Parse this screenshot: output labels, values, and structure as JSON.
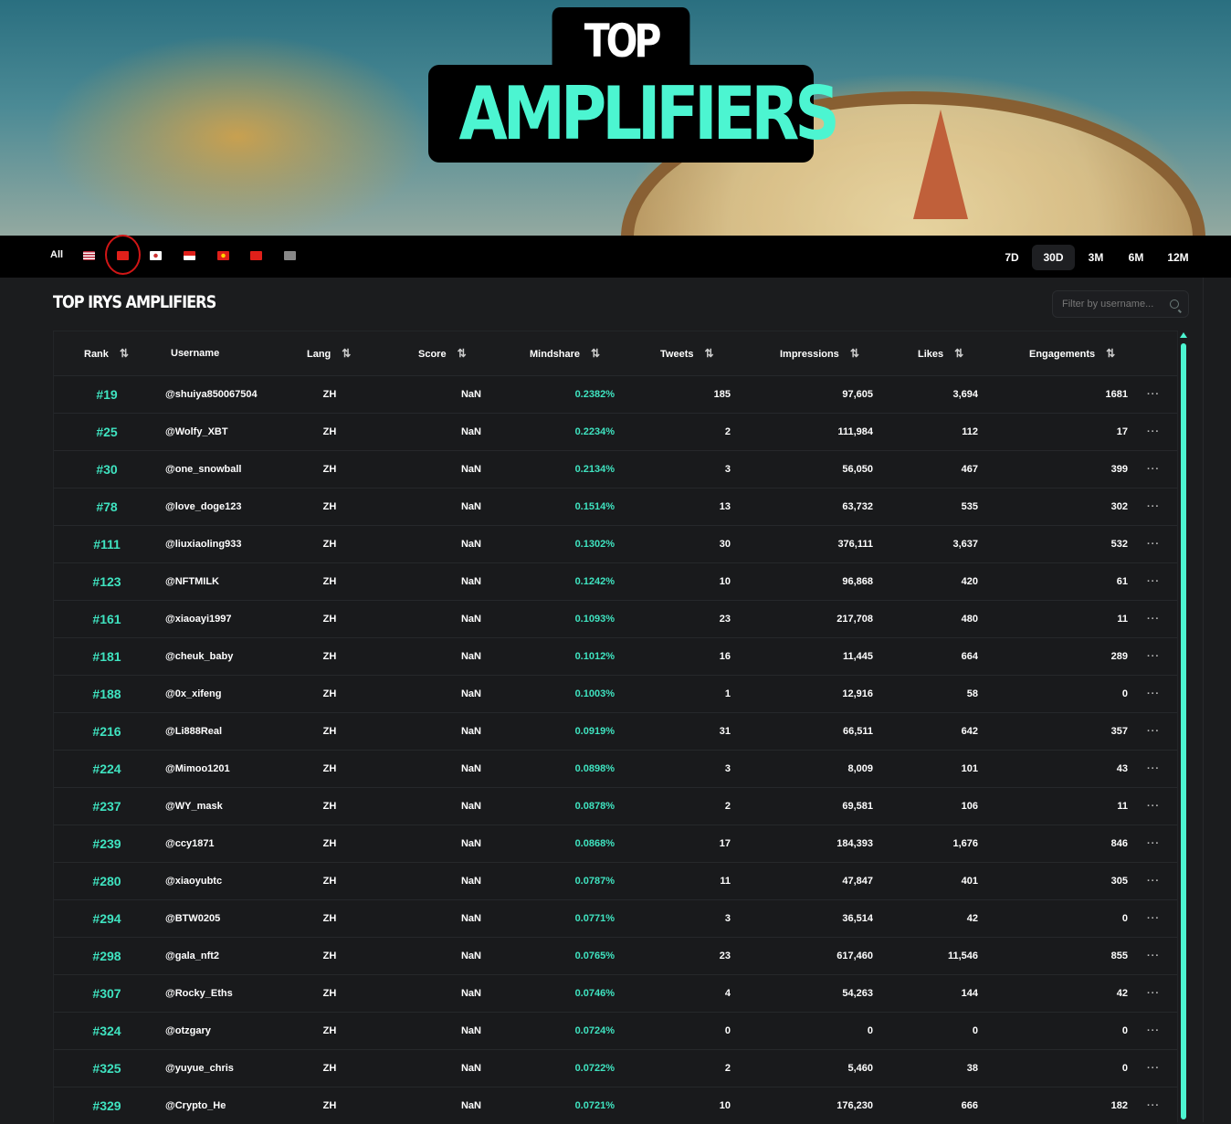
{
  "banner": {
    "title_top": "TOP IRYS",
    "title_bottom": "AMPLIFIERS"
  },
  "nav": {
    "all_label": "All",
    "flags": [
      {
        "name": "us",
        "color": "#b22234"
      },
      {
        "name": "cn",
        "color": "#e0201a",
        "selected": true
      },
      {
        "name": "kr",
        "color": "#ffffff"
      },
      {
        "name": "id",
        "color": "#e0201a"
      },
      {
        "name": "vn",
        "color": "#e0201a"
      },
      {
        "name": "tr",
        "color": "#e0201a"
      },
      {
        "name": "unknown",
        "color": "#888888"
      }
    ],
    "periods": [
      {
        "label": "7D"
      },
      {
        "label": "30D",
        "active": true
      },
      {
        "label": "3M"
      },
      {
        "label": "6M"
      },
      {
        "label": "12M"
      }
    ]
  },
  "page_title": "TOP IRYS AMPLIFIERS",
  "filter": {
    "placeholder": "Filter by username...",
    "icon": "search-icon"
  },
  "accent": "#4cf5d1",
  "columns": [
    "Rank",
    "Username",
    "Lang",
    "Score",
    "Mindshare",
    "Tweets",
    "Impressions",
    "Likes",
    "Engagements"
  ],
  "sort_icon": "⇅",
  "more_icon": "···",
  "rows": [
    {
      "rank": "#19",
      "user": "@shuiya850067504",
      "lang": "ZH",
      "score": "NaN",
      "mind": "0.2382%",
      "tweets": "185",
      "imp": "97,605",
      "likes": "3,694",
      "eng": "1681"
    },
    {
      "rank": "#25",
      "user": "@Wolfy_XBT",
      "lang": "ZH",
      "score": "NaN",
      "mind": "0.2234%",
      "tweets": "2",
      "imp": "111,984",
      "likes": "112",
      "eng": "17"
    },
    {
      "rank": "#30",
      "user": "@one_snowball",
      "lang": "ZH",
      "score": "NaN",
      "mind": "0.2134%",
      "tweets": "3",
      "imp": "56,050",
      "likes": "467",
      "eng": "399"
    },
    {
      "rank": "#78",
      "user": "@love_doge123",
      "lang": "ZH",
      "score": "NaN",
      "mind": "0.1514%",
      "tweets": "13",
      "imp": "63,732",
      "likes": "535",
      "eng": "302"
    },
    {
      "rank": "#111",
      "user": "@liuxiaoling933",
      "lang": "ZH",
      "score": "NaN",
      "mind": "0.1302%",
      "tweets": "30",
      "imp": "376,111",
      "likes": "3,637",
      "eng": "532"
    },
    {
      "rank": "#123",
      "user": "@NFTMILK",
      "lang": "ZH",
      "score": "NaN",
      "mind": "0.1242%",
      "tweets": "10",
      "imp": "96,868",
      "likes": "420",
      "eng": "61"
    },
    {
      "rank": "#161",
      "user": "@xiaoayi1997",
      "lang": "ZH",
      "score": "NaN",
      "mind": "0.1093%",
      "tweets": "23",
      "imp": "217,708",
      "likes": "480",
      "eng": "11"
    },
    {
      "rank": "#181",
      "user": "@cheuk_baby",
      "lang": "ZH",
      "score": "NaN",
      "mind": "0.1012%",
      "tweets": "16",
      "imp": "11,445",
      "likes": "664",
      "eng": "289"
    },
    {
      "rank": "#188",
      "user": "@0x_xifeng",
      "lang": "ZH",
      "score": "NaN",
      "mind": "0.1003%",
      "tweets": "1",
      "imp": "12,916",
      "likes": "58",
      "eng": "0"
    },
    {
      "rank": "#216",
      "user": "@Li888Real",
      "lang": "ZH",
      "score": "NaN",
      "mind": "0.0919%",
      "tweets": "31",
      "imp": "66,511",
      "likes": "642",
      "eng": "357"
    },
    {
      "rank": "#224",
      "user": "@Mimoo1201",
      "lang": "ZH",
      "score": "NaN",
      "mind": "0.0898%",
      "tweets": "3",
      "imp": "8,009",
      "likes": "101",
      "eng": "43"
    },
    {
      "rank": "#237",
      "user": "@WY_mask",
      "lang": "ZH",
      "score": "NaN",
      "mind": "0.0878%",
      "tweets": "2",
      "imp": "69,581",
      "likes": "106",
      "eng": "11"
    },
    {
      "rank": "#239",
      "user": "@ccy1871",
      "lang": "ZH",
      "score": "NaN",
      "mind": "0.0868%",
      "tweets": "17",
      "imp": "184,393",
      "likes": "1,676",
      "eng": "846"
    },
    {
      "rank": "#280",
      "user": "@xiaoyubtc",
      "lang": "ZH",
      "score": "NaN",
      "mind": "0.0787%",
      "tweets": "11",
      "imp": "47,847",
      "likes": "401",
      "eng": "305"
    },
    {
      "rank": "#294",
      "user": "@BTW0205",
      "lang": "ZH",
      "score": "NaN",
      "mind": "0.0771%",
      "tweets": "3",
      "imp": "36,514",
      "likes": "42",
      "eng": "0"
    },
    {
      "rank": "#298",
      "user": "@gala_nft2",
      "lang": "ZH",
      "score": "NaN",
      "mind": "0.0765%",
      "tweets": "23",
      "imp": "617,460",
      "likes": "11,546",
      "eng": "855"
    },
    {
      "rank": "#307",
      "user": "@Rocky_Eths",
      "lang": "ZH",
      "score": "NaN",
      "mind": "0.0746%",
      "tweets": "4",
      "imp": "54,263",
      "likes": "144",
      "eng": "42"
    },
    {
      "rank": "#324",
      "user": "@otzgary",
      "lang": "ZH",
      "score": "NaN",
      "mind": "0.0724%",
      "tweets": "0",
      "imp": "0",
      "likes": "0",
      "eng": "0"
    },
    {
      "rank": "#325",
      "user": "@yuyue_chris",
      "lang": "ZH",
      "score": "NaN",
      "mind": "0.0722%",
      "tweets": "2",
      "imp": "5,460",
      "likes": "38",
      "eng": "0"
    },
    {
      "rank": "#329",
      "user": "@Crypto_He",
      "lang": "ZH",
      "score": "NaN",
      "mind": "0.0721%",
      "tweets": "10",
      "imp": "176,230",
      "likes": "666",
      "eng": "182"
    }
  ]
}
